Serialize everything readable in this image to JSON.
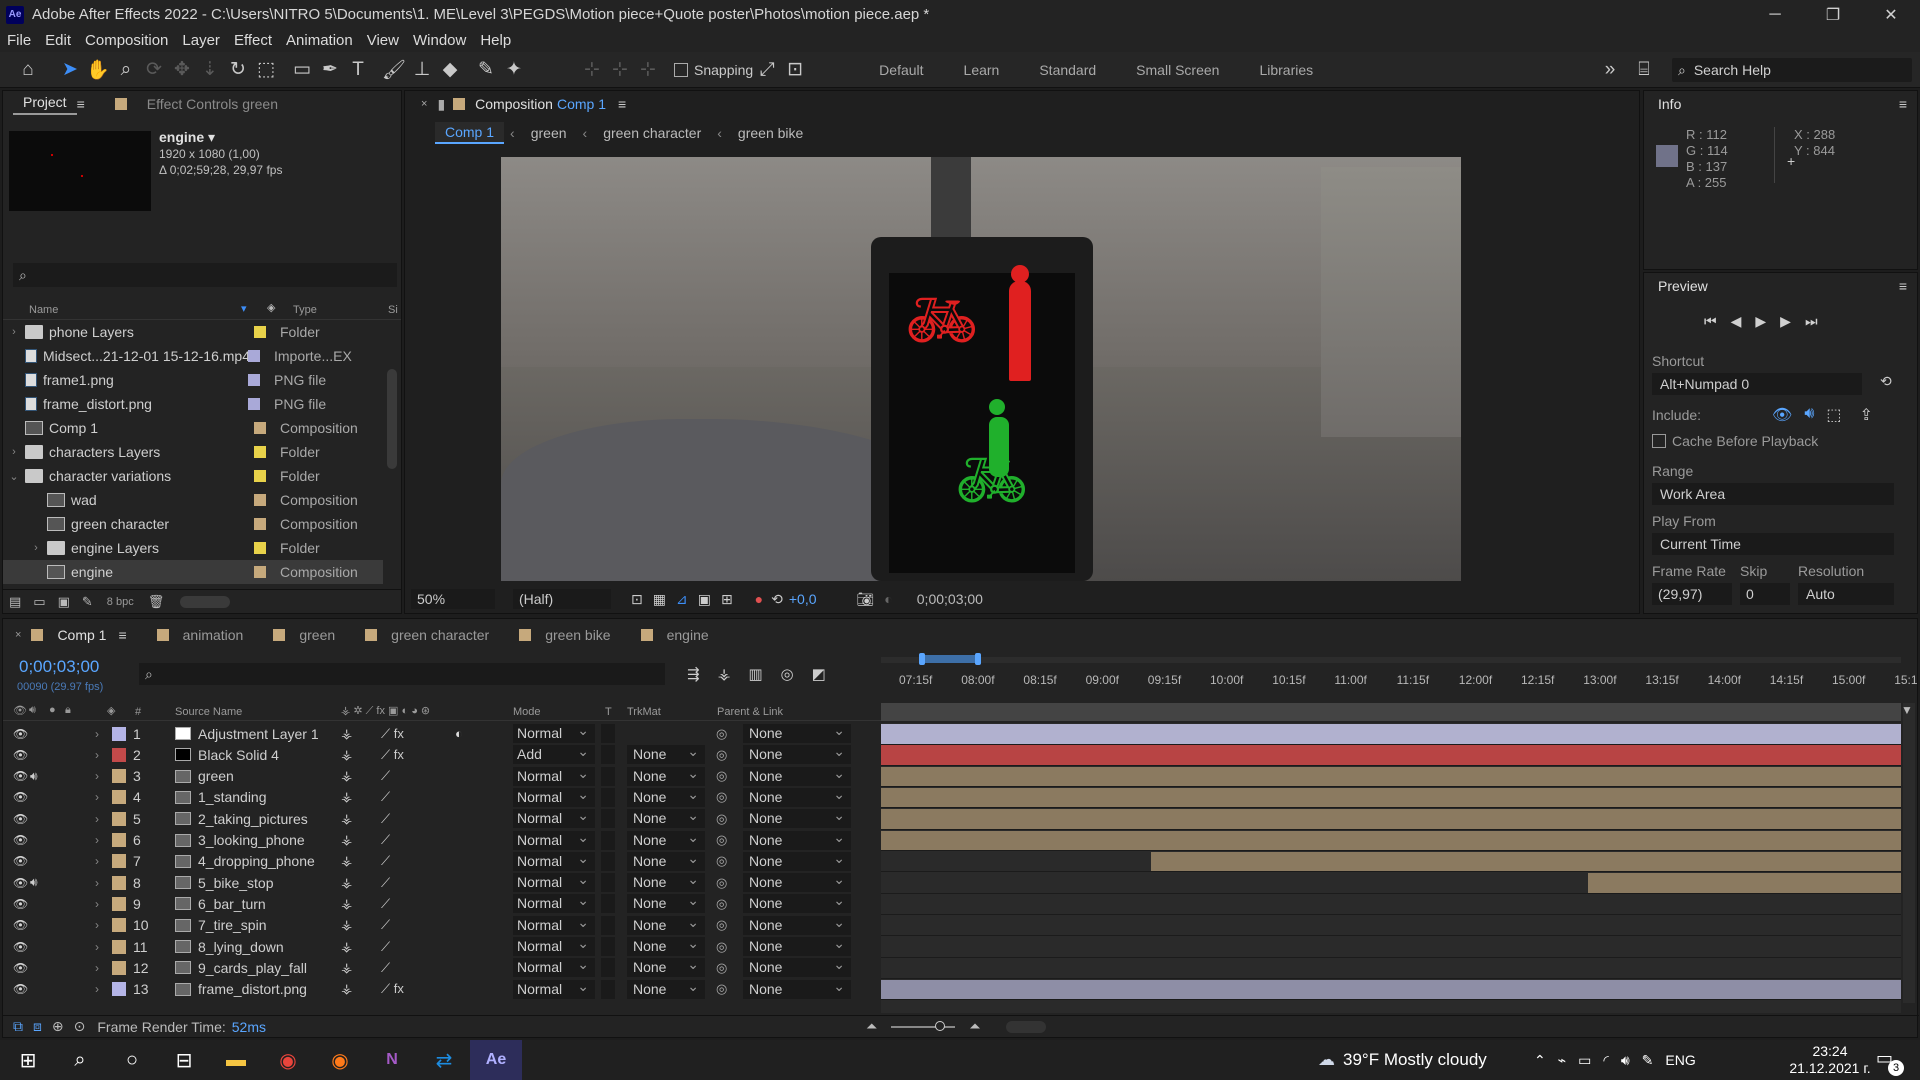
{
  "window": {
    "title": "Adobe After Effects 2022 - C:\\Users\\NITRO 5\\Documents\\1. ME\\Level 3\\PEGDS\\Motion piece+Quote poster\\Photos\\motion piece.aep *",
    "app_icon": "Ae"
  },
  "menu": [
    "File",
    "Edit",
    "Composition",
    "Layer",
    "Effect",
    "Animation",
    "View",
    "Window",
    "Help"
  ],
  "toolbar": {
    "snapping": "Snapping",
    "workspaces": [
      "Default",
      "Learn",
      "Standard",
      "Small Screen",
      "Libraries"
    ],
    "search_placeholder": "Search Help"
  },
  "project": {
    "tab_project": "Project",
    "tab_effects": "Effect Controls green",
    "selected_name": "engine ▾",
    "selected_dims": "1920 x 1080 (1,00)",
    "selected_dur": "Δ 0;02;59;28, 29,97 fps",
    "col_name": "Name",
    "col_type": "Type",
    "col_size": "Si",
    "bpc": "8 bpc",
    "items": [
      {
        "name": "phone Layers",
        "type": "Folder",
        "icon": "folder",
        "arrow": "›",
        "label": "#e8d24a"
      },
      {
        "name": "Midsect...21-12-01 15-12-16.mp4",
        "type": "Importe...EX",
        "icon": "file",
        "arrow": "",
        "label": "#a9a9d8"
      },
      {
        "name": "frame1.png",
        "type": "PNG file",
        "icon": "file",
        "arrow": "",
        "label": "#a9a9d8"
      },
      {
        "name": "frame_distort.png",
        "type": "PNG file",
        "icon": "file",
        "arrow": "",
        "label": "#a9a9d8"
      },
      {
        "name": "Comp 1",
        "type": "Composition",
        "icon": "comp",
        "arrow": "",
        "label": "#c6a97c"
      },
      {
        "name": "characters Layers",
        "type": "Folder",
        "icon": "folder",
        "arrow": "›",
        "label": "#e8d24a"
      },
      {
        "name": "character variations",
        "type": "Folder",
        "icon": "folder",
        "arrow": "⌄",
        "label": "#e8d24a"
      },
      {
        "name": "wad",
        "type": "Composition",
        "icon": "comp",
        "arrow": "",
        "label": "#c6a97c"
      },
      {
        "name": "green character",
        "type": "Composition",
        "icon": "comp",
        "arrow": "",
        "label": "#c6a97c"
      },
      {
        "name": "engine Layers",
        "type": "Folder",
        "icon": "folder",
        "arrow": "›",
        "label": "#e8d24a"
      },
      {
        "name": "engine",
        "type": "Composition",
        "icon": "comp",
        "arrow": "",
        "label": "#c6a97c"
      }
    ]
  },
  "composition": {
    "tab_prefix": "Composition",
    "tab_name": "Comp 1",
    "breadcrumbs": [
      "Comp 1",
      "green",
      "green character",
      "green bike"
    ],
    "zoom": "50%",
    "resolution": "(Half)",
    "exposure": "+0,0",
    "timecode": "0;00;03;00"
  },
  "info": {
    "title": "Info",
    "r": "R : 112",
    "g": "G : 114",
    "b": "B : 137",
    "a": "A : 255",
    "x": "X : 288",
    "y": "Y : 844",
    "swatch": "#707289"
  },
  "preview": {
    "title": "Preview",
    "shortcut_label": "Shortcut",
    "shortcut": "Alt+Numpad 0",
    "include_label": "Include:",
    "cache": "Cache Before Playback",
    "range_label": "Range",
    "range": "Work Area",
    "playfrom_label": "Play From",
    "playfrom": "Current Time",
    "fr_label": "Frame Rate",
    "skip_label": "Skip",
    "res_label": "Resolution",
    "fr": "(29,97)",
    "skip": "0",
    "res": "Auto"
  },
  "timeline": {
    "tabs": [
      {
        "name": "Comp 1",
        "color": "#c6a97c"
      },
      {
        "name": "animation",
        "color": "#c6a97c"
      },
      {
        "name": "green",
        "color": "#c6a97c"
      },
      {
        "name": "green character",
        "color": "#c6a97c"
      },
      {
        "name": "green bike",
        "color": "#c6a97c"
      },
      {
        "name": "engine",
        "color": "#c6a97c"
      }
    ],
    "timecode": "0;00;03;00",
    "frames": "00090 (29.97 fps)",
    "col_source": "Source Name",
    "col_mode": "Mode",
    "col_t": "T",
    "col_trkmat": "TrkMat",
    "col_parent": "Parent & Link",
    "ticks": [
      "07:15f",
      "08:00f",
      "08:15f",
      "09:00f",
      "09:15f",
      "10:00f",
      "10:15f",
      "11:00f",
      "11:15f",
      "12:00f",
      "12:15f",
      "13:00f",
      "13:15f",
      "14:00f",
      "14:15f",
      "15:00f",
      "15:1"
    ],
    "render_label": "Frame Render Time:",
    "render_time": "52ms",
    "layers": [
      {
        "num": "1",
        "name": "Adjustment Layer 1",
        "mode": "Normal",
        "trk": "",
        "parent": "None",
        "label": "#b4b4e6",
        "src": "#ffffff",
        "fx": true,
        "bar": "#b1b1cf",
        "start": 0
      },
      {
        "num": "2",
        "name": "Black Solid 4",
        "mode": "Add",
        "trk": "None",
        "parent": "None",
        "label": "#c34a4a",
        "src": "#000000",
        "fx": true,
        "bar": "#b84444",
        "start": 0
      },
      {
        "num": "3",
        "name": "green",
        "mode": "Normal",
        "trk": "None",
        "parent": "None",
        "label": "#c6a97c",
        "src": "comp",
        "fx": false,
        "bar": "#8b7a60",
        "start": 0,
        "audio": true
      },
      {
        "num": "4",
        "name": "1_standing",
        "mode": "Normal",
        "trk": "None",
        "parent": "None",
        "label": "#c6a97c",
        "src": "comp",
        "fx": false,
        "bar": "#8b7a60",
        "start": 0
      },
      {
        "num": "5",
        "name": "2_taking_pictures",
        "mode": "Normal",
        "trk": "None",
        "parent": "None",
        "label": "#c6a97c",
        "src": "comp",
        "fx": false,
        "bar": "#8b7a60",
        "start": 0
      },
      {
        "num": "6",
        "name": "3_looking_phone",
        "mode": "Normal",
        "trk": "None",
        "parent": "None",
        "label": "#c6a97c",
        "src": "comp",
        "fx": false,
        "bar": "#8b7a60",
        "start": 0
      },
      {
        "num": "7",
        "name": "4_dropping_phone",
        "mode": "Normal",
        "trk": "None",
        "parent": "None",
        "label": "#c6a97c",
        "src": "comp",
        "fx": false,
        "bar": "#8b7a60",
        "start": 0.265
      },
      {
        "num": "8",
        "name": "5_bike_stop",
        "mode": "Normal",
        "trk": "None",
        "parent": "None",
        "label": "#c6a97c",
        "src": "comp",
        "fx": false,
        "bar": "#8b7a60",
        "start": 0.693,
        "audio": true
      },
      {
        "num": "9",
        "name": "6_bar_turn",
        "mode": "Normal",
        "trk": "None",
        "parent": "None",
        "label": "#c6a97c",
        "src": "comp",
        "fx": false,
        "bar": "",
        "start": 0
      },
      {
        "num": "10",
        "name": "7_tire_spin",
        "mode": "Normal",
        "trk": "None",
        "parent": "None",
        "label": "#c6a97c",
        "src": "comp",
        "fx": false,
        "bar": "",
        "start": 0
      },
      {
        "num": "11",
        "name": "8_lying_down",
        "mode": "Normal",
        "trk": "None",
        "parent": "None",
        "label": "#c6a97c",
        "src": "comp",
        "fx": false,
        "bar": "",
        "start": 0
      },
      {
        "num": "12",
        "name": "9_cards_play_fall",
        "mode": "Normal",
        "trk": "None",
        "parent": "None",
        "label": "#c6a97c",
        "src": "comp",
        "fx": false,
        "bar": "",
        "start": 0
      },
      {
        "num": "13",
        "name": "frame_distort.png",
        "mode": "Normal",
        "trk": "None",
        "parent": "None",
        "label": "#b4b4e6",
        "src": "file",
        "fx": true,
        "bar": "#8e8ea6",
        "start": 0
      }
    ]
  },
  "taskbar": {
    "weather": "39°F  Mostly cloudy",
    "lang": "ENG",
    "time": "23:24",
    "date": "21.12.2021 г.",
    "notif": "3"
  }
}
